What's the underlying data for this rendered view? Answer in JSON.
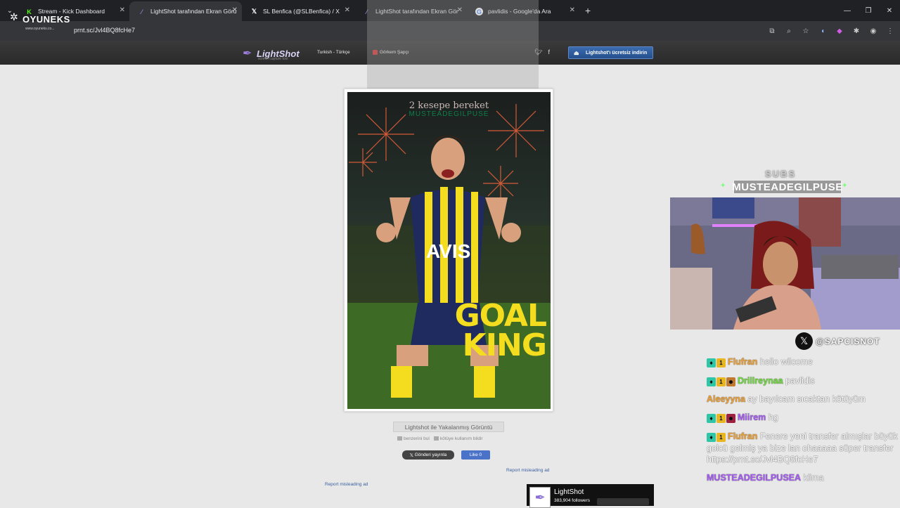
{
  "browser": {
    "tabs": [
      {
        "title": "Stream - Kick Dashboard",
        "favicon": "K",
        "favicon_color": "#53fc18",
        "active": false
      },
      {
        "title": "LightShot tarafından Ekran Görü",
        "favicon": "feather",
        "favicon_color": "#9b7fe0",
        "active": true
      },
      {
        "title": "SL Benfica (@SLBenfica) / X",
        "favicon": "X",
        "favicon_color": "#ffffff",
        "active": false
      },
      {
        "title": "LightShot tarafından Ekran Gör",
        "favicon": "feather",
        "favicon_color": "#9b7fe0",
        "active": false
      },
      {
        "title": "pavlidis - Google'da Ara",
        "favicon": "G",
        "favicon_color": "#4285f4",
        "active": false
      }
    ],
    "url": "prnt.sc/Jvl4BQ8fcHe7"
  },
  "overlay_logo": {
    "name": "OYUNEKS",
    "sub": "www.oyuneks.co..."
  },
  "lightshot": {
    "brand": "LightShot",
    "tagline": "screen capture tool",
    "language": "Turkish - Türkçe",
    "report_label": "Görkem Şapçı",
    "download_label": "Lightshot'ı ücretsiz indirin",
    "image_title": "Lightshot ile Yakalanmış Görüntü",
    "similar_label": "benzerini bul",
    "abuse_label": "kötüye kullanım bildir",
    "tweet_label": "Gönderi yayınla",
    "like_label": "Like 0",
    "misleading_ad_1": "Report misleading ad",
    "misleading_ad_2": "Report misleading ad",
    "fb_page": "LightShot",
    "fb_followers": "383,904 followers"
  },
  "screenshot": {
    "caption_top": "2 kesepe bereket",
    "caption_name": "MUSTEADEGILPUSE",
    "jersey_sponsor": "AVIS",
    "goal_line1": "GOAL",
    "goal_line2": "KING"
  },
  "stream_overlay": {
    "sub_goal_label": "SUBS",
    "latest_sub": "MUSTEADEGILPUSE",
    "x_handle": "@SAPCISNOT"
  },
  "chat": [
    {
      "user": "Flufran",
      "user_color": "#f0a030",
      "badges": [
        "sub",
        "one"
      ],
      "text": "hello wilcome"
    },
    {
      "user": "Drillreynaa",
      "user_color": "#6edc3a",
      "badges": [
        "sub",
        "one",
        "face"
      ],
      "text": "pavlidis"
    },
    {
      "user": "Aleeyyna",
      "user_color": "#f0a030",
      "badges": [],
      "text": "ay bayılcam sıcaktan kötüyüm"
    },
    {
      "user": "Miirem",
      "user_color": "#a75cf5",
      "badges": [
        "sub",
        "one",
        "devil"
      ],
      "text": "hg"
    },
    {
      "user": "Flufran",
      "user_color": "#f0a030",
      "badges": [
        "sub",
        "one"
      ],
      "text": "Fenere yeni transfer almışlar büyük golcü gelmiş ya bize lan ohaaaaa süper transfer https://prnt.sc/Jvl4BQ8fcHe7"
    },
    {
      "user": "MUSTEADEGILPUSEA",
      "user_color": "#a75cf5",
      "badges": [],
      "text": "klima"
    }
  ],
  "colors": {
    "accent_blue": "#2f5fa0",
    "goal_yellow": "#f4dc1e"
  }
}
